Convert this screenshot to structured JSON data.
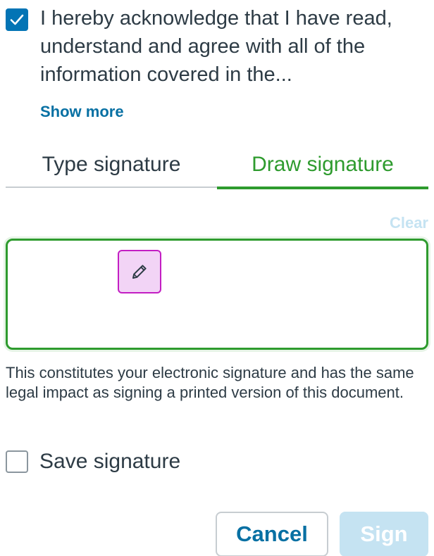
{
  "acknowledgement": {
    "checked": true,
    "text": "I hereby acknowledge that I have read, understand and agree with all of the information covered in the...",
    "show_more": "Show more"
  },
  "tabs": [
    {
      "label": "Type signature",
      "selected": false
    },
    {
      "label": "Draw signature",
      "selected": true
    }
  ],
  "pad": {
    "clear_label": "Clear",
    "tool_icon": "pencil-icon"
  },
  "disclaimer": "This constitutes your electronic signature and has the same legal impact as signing a printed version of this document.",
  "save_signature": {
    "label": "Save signature",
    "checked": false
  },
  "actions": {
    "cancel_label": "Cancel",
    "sign_label": "Sign"
  },
  "colors": {
    "accent_blue": "#0770a3",
    "checkbox_blue": "#0374b5",
    "active_green": "#2e9b2e",
    "disabled_blue": "#c5e3f2",
    "tool_magenta": "#c31ec3",
    "tool_fill": "#f2d4f6"
  }
}
